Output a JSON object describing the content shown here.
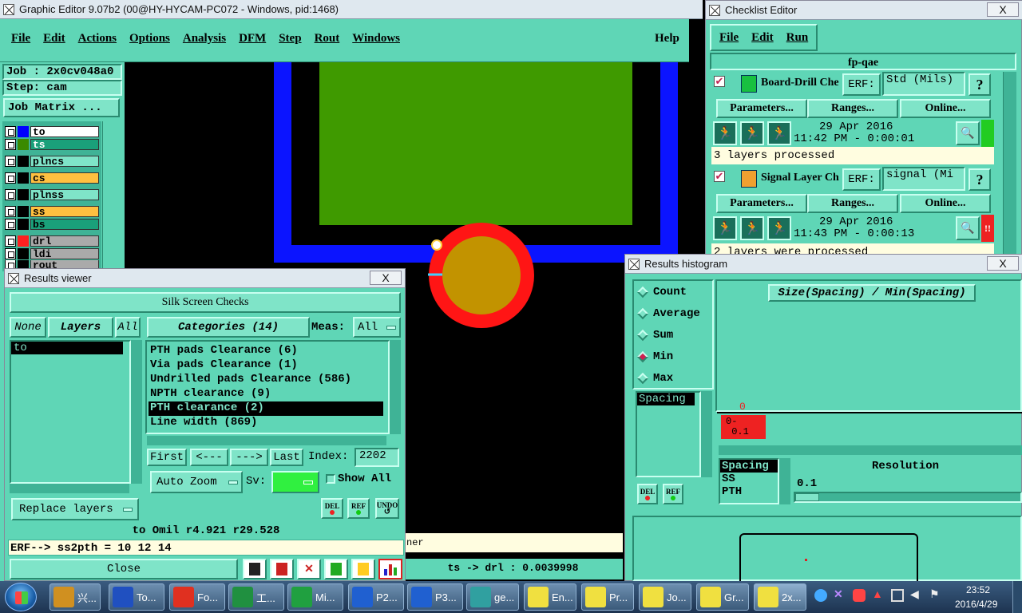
{
  "main_window": {
    "title": "Graphic Editor 9.07b2 (00@HY-HYCAM-PC072 - Windows, pid:1468)",
    "menu": [
      "File",
      "Edit",
      "Actions",
      "Options",
      "Analysis",
      "DFM",
      "Step",
      "Rout",
      "Windows"
    ],
    "help": "Help",
    "job": "Job : 2x0cv048a0",
    "step": "Step: cam",
    "job_matrix": "Job Matrix ...",
    "layers": [
      {
        "name": "to",
        "color": "#0000ff",
        "sel": true
      },
      {
        "name": "ts",
        "color": "#3a8a00"
      },
      {
        "name": "plncs",
        "color": ""
      },
      {
        "name": "cs",
        "color": "",
        "hl": "#ffc040"
      },
      {
        "name": "plnss",
        "color": ""
      },
      {
        "name": "ss",
        "color": "",
        "hl": "#ffc040"
      },
      {
        "name": "bs",
        "color": ""
      },
      {
        "name": "drl",
        "color": "#ff2020",
        "hl": "#aaaaaa"
      },
      {
        "name": "ldi",
        "color": "",
        "hl": "#aaaaaa"
      },
      {
        "name": "rout",
        "color": "",
        "hl": "#aaaaaa"
      }
    ],
    "status_left": "ner",
    "status_bottom": "ts -> drl : 0.0039998"
  },
  "checklist": {
    "title": "Checklist Editor",
    "menu": [
      "File",
      "Edit",
      "Run"
    ],
    "name": "fp-qae",
    "items": [
      {
        "label": "Board-Drill Che",
        "erf_label": "ERF:",
        "erf_value": "Std (Mils)",
        "help": "?",
        "params": "Parameters...",
        "ranges": "Ranges...",
        "online": "Online...",
        "date": "29 Apr 2016",
        "time": "11:42 PM - 0:00:01",
        "status": "3 layers processed",
        "flag_color": "#22cc22",
        "flag": ""
      },
      {
        "label": "Signal Layer Ch",
        "erf_label": "ERF:",
        "erf_value": "signal (Mi",
        "help": "?",
        "params": "Parameters...",
        "ranges": "Ranges...",
        "online": "Online...",
        "date": "29 Apr 2016",
        "time": "11:43 PM - 0:00:13",
        "status": "2 layers were processed",
        "flag_color": "#ee2222",
        "flag": "!!"
      }
    ]
  },
  "results_viewer": {
    "title": "Results viewer",
    "close_x": "X",
    "header": "Silk Screen Checks",
    "none": "None",
    "layers": "Layers",
    "all": "All",
    "layer_list": [
      "to"
    ],
    "categories": "Categories (14)",
    "meas_label": "Meas:",
    "meas_value": "All",
    "items": [
      "PTH pads Clearance (6)",
      "Via pads Clearance (1)",
      "Undrilled pads Clearance (586)",
      "NPTH clearance (9)",
      "PTH clearance (2)",
      "Line width (869)"
    ],
    "selected_index": 4,
    "first": "First",
    "prev": "<---",
    "next": "--->",
    "last": "Last",
    "index_label": "Index:",
    "index_value": "2202",
    "auto_zoom": "Auto Zoom",
    "sv": "Sv:",
    "show_all": "Show All",
    "replace": "Replace layers",
    "del": "DEL",
    "ref": "REF",
    "undo": "UNDO",
    "coords": "to Omil  r4.921  r29.528",
    "erf_line": "ERF--> ss2pth = 10 12 14",
    "close": "Close"
  },
  "histogram": {
    "title": "Results histogram",
    "close_x": "X",
    "modes": [
      "Count",
      "Average",
      "Sum",
      "Min",
      "Max"
    ],
    "active_mode": "Min",
    "plot_title": "Size(Spacing) / Min(Spacing)",
    "list1": [
      "Spacing"
    ],
    "bar_count": "0",
    "bar_range": "0-\n 0.1",
    "list2": [
      "Spacing",
      "SS",
      "PTH"
    ],
    "resolution_label": "Resolution",
    "resolution_value": "0.1",
    "del": "DEL",
    "ref": "REF"
  },
  "taskbar": {
    "items": [
      {
        "label": "兴...",
        "color": "#d09020"
      },
      {
        "label": "To...",
        "color": "#2050c0"
      },
      {
        "label": "Fo...",
        "color": "#e03020"
      },
      {
        "label": "工...",
        "color": "#209040"
      },
      {
        "label": "Mi...",
        "color": "#20a040"
      },
      {
        "label": "P2...",
        "color": "#2060d0"
      },
      {
        "label": "P3...",
        "color": "#2060d0"
      },
      {
        "label": "ge...",
        "color": "#30a0a0"
      },
      {
        "label": "En...",
        "color": "#f0e040"
      },
      {
        "label": "Pr...",
        "color": "#f0e040"
      },
      {
        "label": "Jo...",
        "color": "#f0e040"
      },
      {
        "label": "Gr...",
        "color": "#f0e040"
      },
      {
        "label": "2x...",
        "color": "#f0e040"
      }
    ],
    "time": "23:52",
    "date": "2016/4/29"
  }
}
